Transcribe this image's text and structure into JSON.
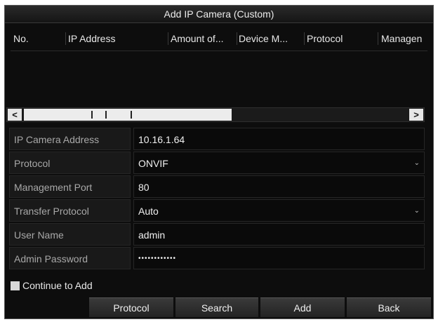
{
  "dialog": {
    "title": "Add IP Camera (Custom)"
  },
  "table": {
    "columns": [
      "No.",
      "IP Address",
      "Amount of...",
      "Device M...",
      "Protocol",
      "Managen"
    ]
  },
  "scrollbar": {
    "left_arrow": "<",
    "right_arrow": ">"
  },
  "form": {
    "ip_camera_address": {
      "label": "IP Camera Address",
      "value": "10.16.1.64"
    },
    "protocol": {
      "label": "Protocol",
      "value": "ONVIF"
    },
    "management_port": {
      "label": "Management Port",
      "value": "80"
    },
    "transfer_protocol": {
      "label": "Transfer Protocol",
      "value": "Auto"
    },
    "user_name": {
      "label": "User Name",
      "value": "admin"
    },
    "admin_password": {
      "label": "Admin Password",
      "value": "••••••••••••"
    }
  },
  "continue_to_add": {
    "label": "Continue to Add"
  },
  "buttons": {
    "protocol": "Protocol",
    "search": "Search",
    "add": "Add",
    "back": "Back"
  },
  "icons": {
    "dropdown": "chevron-down-icon",
    "scroll_left": "chevron-left-icon",
    "scroll_right": "chevron-right-icon"
  }
}
